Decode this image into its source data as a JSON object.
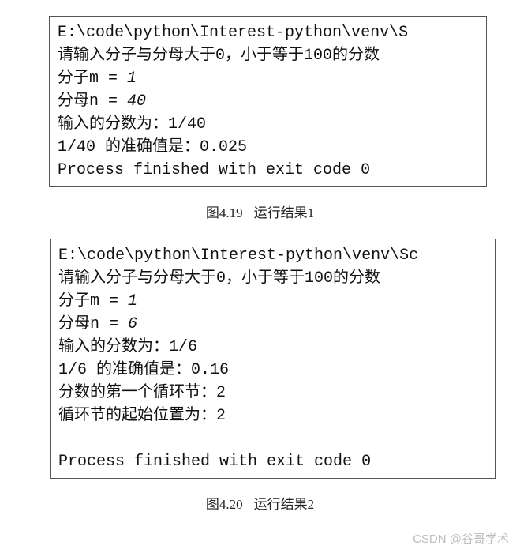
{
  "box1": {
    "lines": [
      "E:\\code\\python\\Interest-python\\venv\\S",
      "请输入分子与分母大于0，小于等于100的分数",
      "分子m = 1",
      "分母n = 40",
      "输入的分数为：1/40",
      "1/40 的准确值是：0.025",
      "Process finished with exit code 0"
    ]
  },
  "caption1": {
    "label": "图4.19",
    "title": "运行结果1"
  },
  "box2": {
    "lines": [
      "E:\\code\\python\\Interest-python\\venv\\Sc",
      "请输入分子与分母大于0，小于等于100的分数",
      "分子m = 1",
      "分母n = 6",
      "输入的分数为：1/6",
      "1/6 的准确值是：0.16",
      "分数的第一个循环节：2",
      "循环节的起始位置为：2",
      "",
      "Process finished with exit code 0"
    ]
  },
  "caption2": {
    "label": "图4.20",
    "title": "运行结果2"
  },
  "watermark": "CSDN @谷哥学术"
}
